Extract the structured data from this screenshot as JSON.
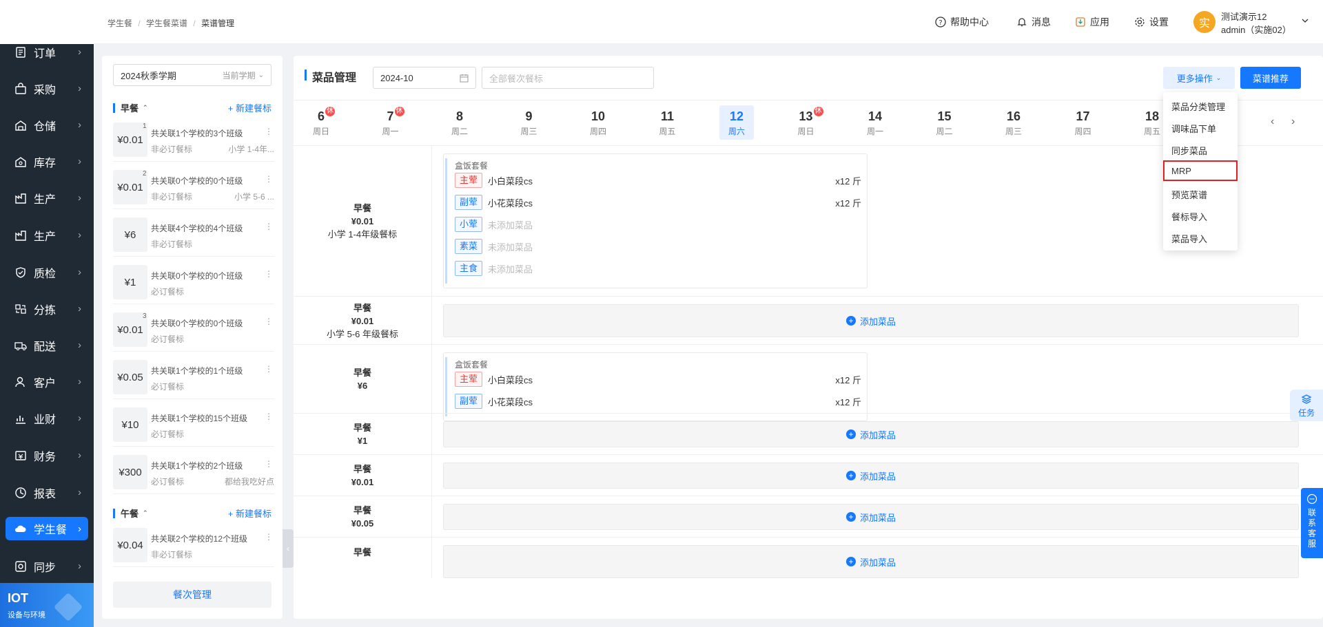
{
  "nav": {
    "items": [
      {
        "label": "订单",
        "icon": "order-icon"
      },
      {
        "label": "采购",
        "icon": "purchase-icon"
      },
      {
        "label": "仓储",
        "icon": "warehouse-icon"
      },
      {
        "label": "库存",
        "icon": "inventory-icon"
      },
      {
        "label": "生产",
        "icon": "production-icon"
      },
      {
        "label": "生产",
        "icon": "production-icon"
      },
      {
        "label": "质检",
        "icon": "shield-icon"
      },
      {
        "label": "分拣",
        "icon": "sorting-icon"
      },
      {
        "label": "配送",
        "icon": "truck-icon"
      },
      {
        "label": "客户",
        "icon": "user-icon"
      },
      {
        "label": "业财",
        "icon": "chart-icon"
      },
      {
        "label": "财务",
        "icon": "finance-icon"
      },
      {
        "label": "报表",
        "icon": "report-icon"
      },
      {
        "label": "学生餐",
        "icon": "cloud-icon",
        "active": true
      },
      {
        "label": "同步",
        "icon": "sync-icon"
      }
    ],
    "iot_title": "IOT",
    "iot_sub": "设备与环境"
  },
  "header": {
    "breadcrumb": [
      "学生餐",
      "学生餐菜谱",
      "菜谱管理"
    ],
    "help": "帮助中心",
    "messages": "消息",
    "apps": "应用",
    "settings": "设置",
    "avatar_char": "实",
    "user_name": "测试演示12",
    "user_role": "admin（实施02）"
  },
  "meal_panel": {
    "semester": "2024秋季学期",
    "semester_tag": "当前学期",
    "breakfast_title": "早餐",
    "lunch_title": "午餐",
    "new_label": "+ 新建餐标",
    "breakfast_items": [
      {
        "price": "¥0.01",
        "count": "1",
        "line1": "共关联1个学校的3个班级",
        "line2": "非必订餐标",
        "line3": "小学 1-4年..."
      },
      {
        "price": "¥0.01",
        "count": "2",
        "line1": "共关联0个学校的0个班级",
        "line2": "非必订餐标",
        "line3": "小学 5-6 ..."
      },
      {
        "price": "¥6",
        "count": "",
        "line1": "共关联4个学校的4个班级",
        "line2": "非必订餐标",
        "line3": ""
      },
      {
        "price": "¥1",
        "count": "",
        "line1": "共关联0个学校的0个班级",
        "line2": "必订餐标",
        "line3": ""
      },
      {
        "price": "¥0.01",
        "count": "3",
        "line1": "共关联0个学校的0个班级",
        "line2": "必订餐标",
        "line3": ""
      },
      {
        "price": "¥0.05",
        "count": "",
        "line1": "共关联1个学校的1个班级",
        "line2": "必订餐标",
        "line3": ""
      },
      {
        "price": "¥10",
        "count": "",
        "line1": "共关联1个学校的15个班级",
        "line2": "必订餐标",
        "line3": ""
      },
      {
        "price": "¥300",
        "count": "",
        "line1": "共关联1个学校的2个班级",
        "line2": "必订餐标",
        "line3": "都给我吃好点"
      }
    ],
    "lunch_items": [
      {
        "price": "¥0.04",
        "count": "",
        "line1": "共关联2个学校的12个班级",
        "line2": "非必订餐标",
        "line3": ""
      }
    ],
    "manage_label": "餐次管理"
  },
  "main": {
    "title": "菜品管理",
    "month": "2024-10",
    "meal_filter_placeholder": "全部餐次餐标",
    "more_ops": "更多操作",
    "recommend": "菜谱推荐",
    "days": [
      {
        "num": "6",
        "week": "周日",
        "rest": "休"
      },
      {
        "num": "7",
        "week": "周一",
        "rest": "休"
      },
      {
        "num": "8",
        "week": "周二",
        "rest": ""
      },
      {
        "num": "9",
        "week": "周三",
        "rest": ""
      },
      {
        "num": "10",
        "week": "周四",
        "rest": ""
      },
      {
        "num": "11",
        "week": "周五",
        "rest": ""
      },
      {
        "num": "12",
        "week": "周六",
        "rest": "",
        "selected": true
      },
      {
        "num": "13",
        "week": "周日",
        "rest": "休"
      },
      {
        "num": "14",
        "week": "周一",
        "rest": ""
      },
      {
        "num": "15",
        "week": "周二",
        "rest": ""
      },
      {
        "num": "16",
        "week": "周三",
        "rest": ""
      },
      {
        "num": "17",
        "week": "周四",
        "rest": ""
      },
      {
        "num": "18",
        "week": "周五",
        "rest": ""
      }
    ],
    "rows": [
      {
        "meal": "早餐",
        "price": "¥0.01",
        "standard": "小学 1-4年级餐标",
        "type": "card",
        "card_title": "盒饭套餐",
        "dishes": [
          {
            "tag": "主荤",
            "tag_color": "red",
            "name": "小白菜段cs",
            "qty": "x12 斤"
          },
          {
            "tag": "副荤",
            "tag_color": "blue",
            "name": "小花菜段cs",
            "qty": "x12 斤"
          },
          {
            "tag": "小荤",
            "tag_color": "blue",
            "name": "未添加菜品",
            "qty": ""
          },
          {
            "tag": "素菜",
            "tag_color": "blue",
            "name": "未添加菜品",
            "qty": ""
          },
          {
            "tag": "主食",
            "tag_color": "blue",
            "name": "未添加菜品",
            "qty": ""
          }
        ]
      },
      {
        "meal": "早餐",
        "price": "¥0.01",
        "standard": "小学 5-6 年级餐标",
        "type": "add"
      },
      {
        "meal": "早餐",
        "price": "¥6",
        "standard": "",
        "type": "card",
        "card_title": "盒饭套餐",
        "dishes": [
          {
            "tag": "主荤",
            "tag_color": "red",
            "name": "小白菜段cs",
            "qty": "x12 斤"
          },
          {
            "tag": "副荤",
            "tag_color": "blue",
            "name": "小花菜段cs",
            "qty": "x12 斤"
          }
        ]
      },
      {
        "meal": "早餐",
        "price": "¥1",
        "standard": "",
        "type": "add"
      },
      {
        "meal": "早餐",
        "price": "¥0.01",
        "standard": "",
        "type": "add"
      },
      {
        "meal": "早餐",
        "price": "¥0.05",
        "standard": "",
        "type": "add"
      },
      {
        "meal": "早餐",
        "price": "",
        "standard": "",
        "type": "add"
      }
    ],
    "add_label": "添加菜品"
  },
  "dropdown": {
    "items": [
      "菜品分类管理",
      "调味品下单",
      "同步菜品",
      "MRP",
      "预览菜谱",
      "餐标导入",
      "菜品导入"
    ],
    "highlighted": "MRP"
  },
  "float": {
    "task": "任务",
    "customer_service": "联系客服"
  },
  "colors": {
    "primary": "#1677ff",
    "nav_bg": "#202a35",
    "highlight": "#e02020",
    "rest_badge": "#ff4d4f"
  }
}
